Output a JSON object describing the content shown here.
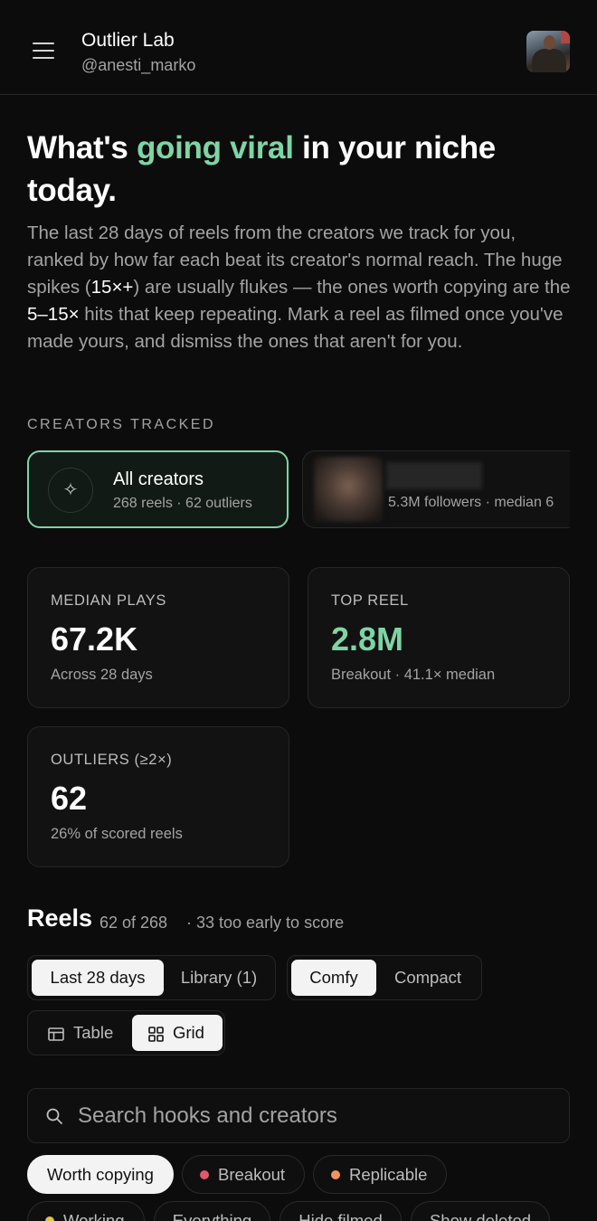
{
  "header": {
    "app_title": "Outlier Lab",
    "username": "@anesti_marko"
  },
  "hero": {
    "headline_pre": "What's ",
    "headline_accent": "going viral",
    "headline_post": " in your niche today.",
    "lead_1": "The last 28 days of reels from the creators we track for you, ranked by how far each beat its creator's normal reach. The huge spikes (",
    "lead_hl_1": "15×+",
    "lead_2": ") are usually flukes — the ones worth copying are the ",
    "lead_hl_2": "5–15×",
    "lead_3": " hits that keep repeating. Mark a reel as filmed once you've made yours, and dismiss the ones that aren't for you."
  },
  "creators": {
    "section_label": "CREATORS TRACKED",
    "all": {
      "name": "All creators",
      "meta": "268 reels · 62 outliers"
    },
    "card": {
      "meta": "5.3M followers · median 6"
    }
  },
  "stats": [
    {
      "label": "MEDIAN PLAYS",
      "value": "67.2K",
      "sub": "Across 28 days"
    },
    {
      "label": "TOP REEL",
      "value": "2.8M",
      "sub": "Breakout · 41.1× median"
    },
    {
      "label": "OUTLIERS (≥2×)",
      "value": "62",
      "sub": "26% of scored reels"
    }
  ],
  "reels": {
    "title": "Reels",
    "count": "62 of 268",
    "early": "· 33 too early to score",
    "range_tabs": [
      "Last 28 days",
      "Library (1)"
    ],
    "density_tabs": [
      "Comfy",
      "Compact"
    ],
    "view_tabs": [
      "Table",
      "Grid"
    ],
    "search_placeholder": "Search hooks and creators",
    "filters": [
      {
        "label": "Worth copying",
        "dot": null
      },
      {
        "label": "Breakout",
        "dot": "#e05a6a"
      },
      {
        "label": "Replicable",
        "dot": "#f0955a"
      },
      {
        "label": "Working",
        "dot": "#e6c24a"
      },
      {
        "label": "Everything",
        "dot": null
      },
      {
        "label": "Hide filmed",
        "dot": null
      },
      {
        "label": "Show deleted",
        "dot": null
      }
    ]
  },
  "colors": {
    "accent": "#7fd4a5",
    "background": "#0c0c0c"
  },
  "icons": {
    "menu": "hamburger-icon",
    "all_creators": "sparkle-icon",
    "table": "table-icon",
    "grid": "grid-icon",
    "search": "search-icon"
  }
}
